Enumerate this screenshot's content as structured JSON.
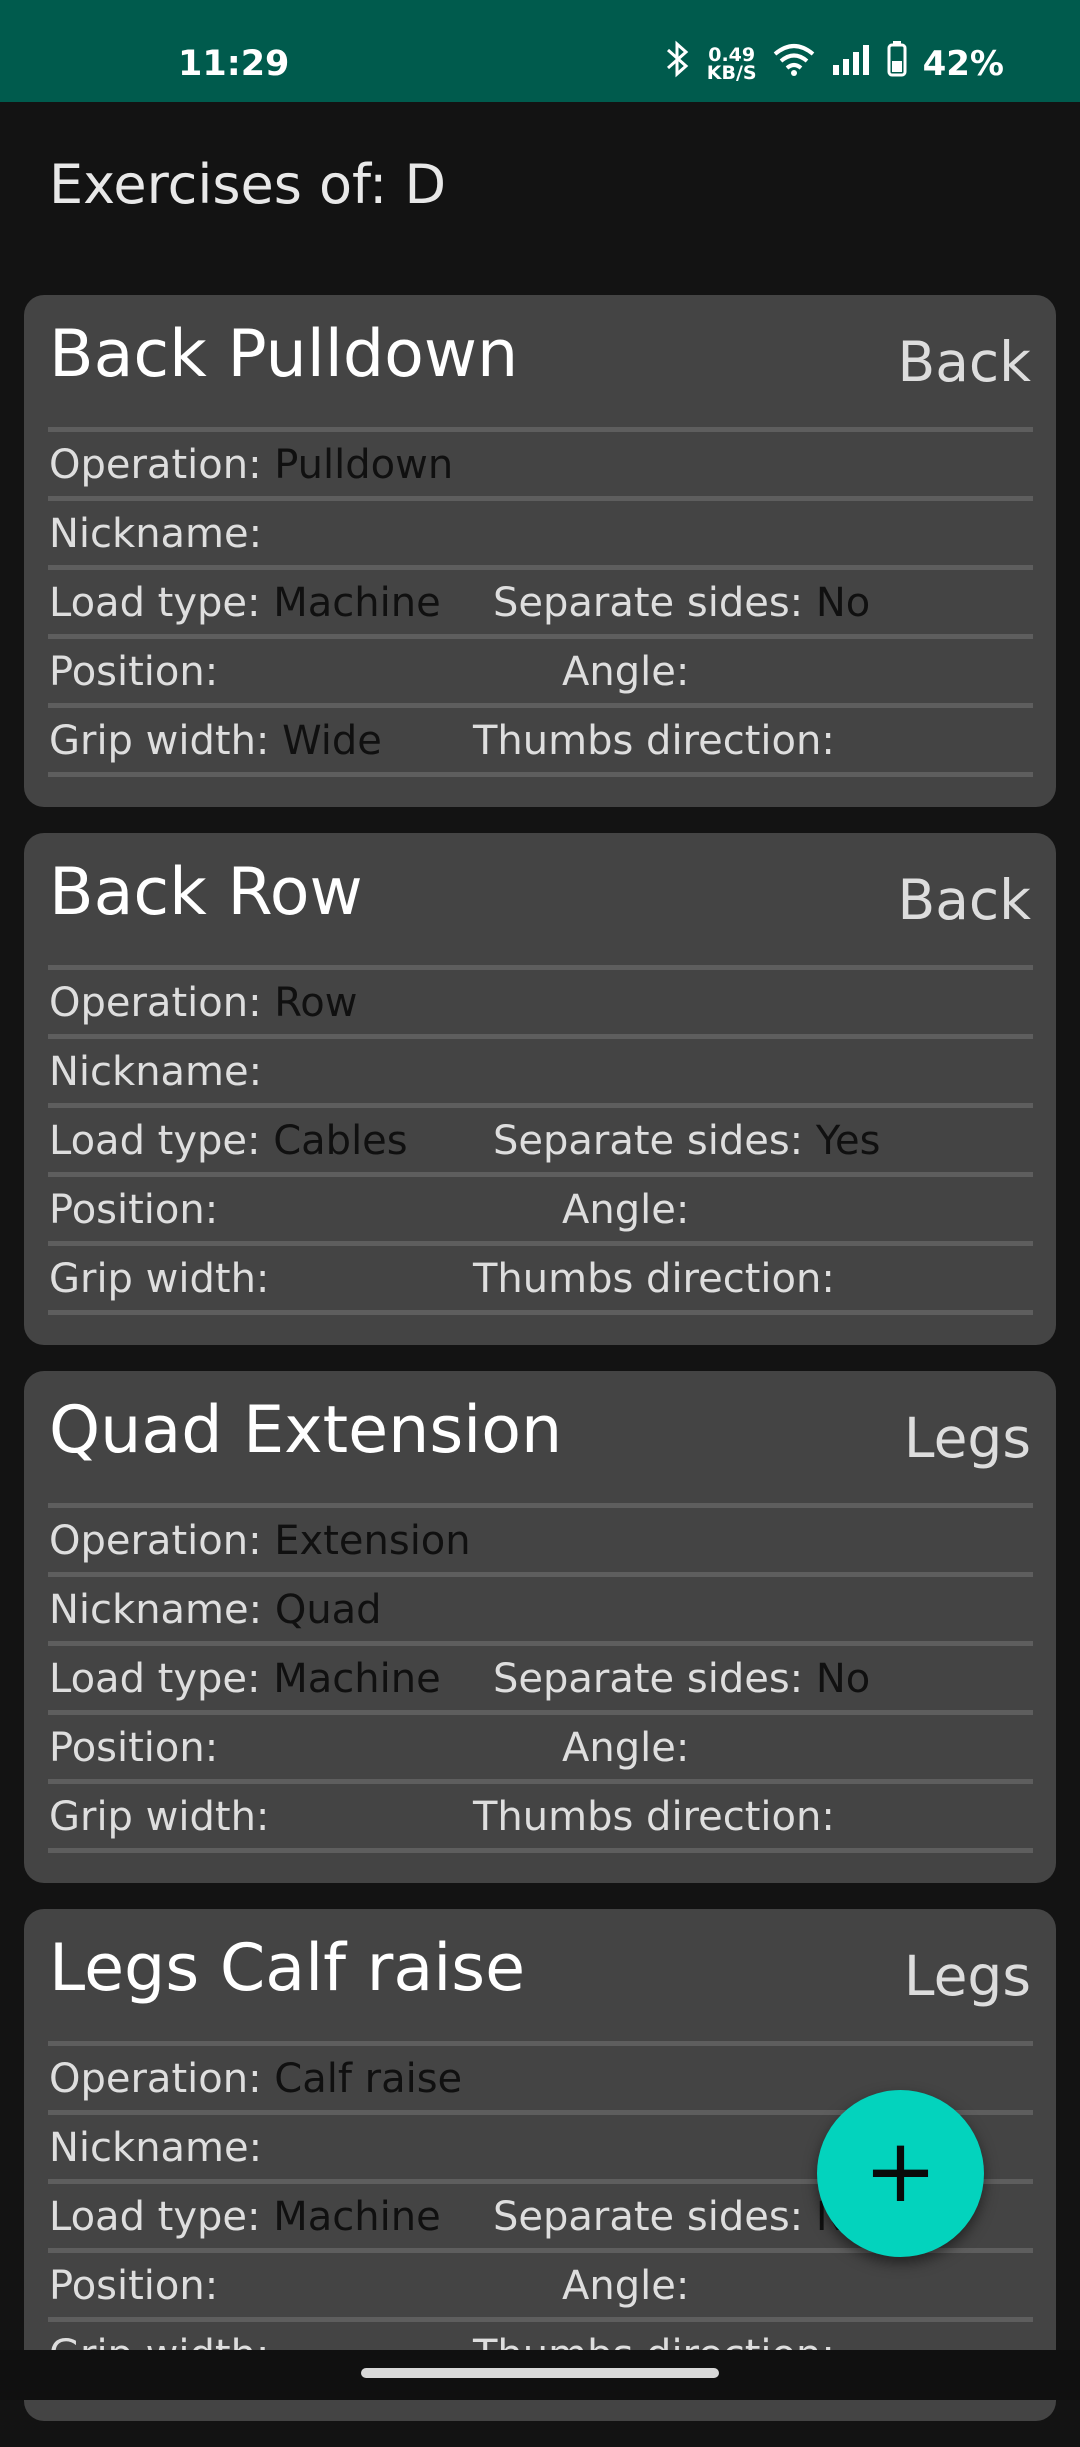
{
  "status_bar": {
    "time": "11:29",
    "net_speed_value": "0.49",
    "net_speed_unit": "KB/S",
    "battery": "42%"
  },
  "page": {
    "title": "Exercises of: D"
  },
  "labels": {
    "operation": "Operation:",
    "nickname": "Nickname:",
    "load_type": "Load type:",
    "separate_sides": "Separate sides:",
    "position": "Position:",
    "angle": "Angle:",
    "grip_width": "Grip width:",
    "thumbs_direction": "Thumbs direction:"
  },
  "exercises": [
    {
      "name": "Back Pulldown",
      "group": "Back",
      "operation": "Pulldown",
      "nickname": "",
      "load_type": "Machine",
      "separate_sides": "No",
      "position": "",
      "angle": "",
      "grip_width": "Wide",
      "thumbs_direction": ""
    },
    {
      "name": "Back Row",
      "group": "Back",
      "operation": "Row",
      "nickname": "",
      "load_type": "Cables",
      "separate_sides": "Yes",
      "position": "",
      "angle": "",
      "grip_width": "",
      "thumbs_direction": ""
    },
    {
      "name": "Quad Extension",
      "group": "Legs",
      "operation": "Extension",
      "nickname": "Quad",
      "load_type": "Machine",
      "separate_sides": "No",
      "position": "",
      "angle": "",
      "grip_width": "",
      "thumbs_direction": ""
    },
    {
      "name": "Legs Calf raise",
      "group": "Legs",
      "operation": "Calf raise",
      "nickname": "",
      "load_type": "Machine",
      "separate_sides": "No",
      "position": "",
      "angle": "",
      "grip_width": "",
      "thumbs_direction": ""
    }
  ],
  "fab": {
    "label": "+",
    "icon": "plus-icon",
    "color": "#03d3bd"
  },
  "colors": {
    "status_bar": "#005b4d",
    "card": "#444444",
    "background": "#131313"
  }
}
